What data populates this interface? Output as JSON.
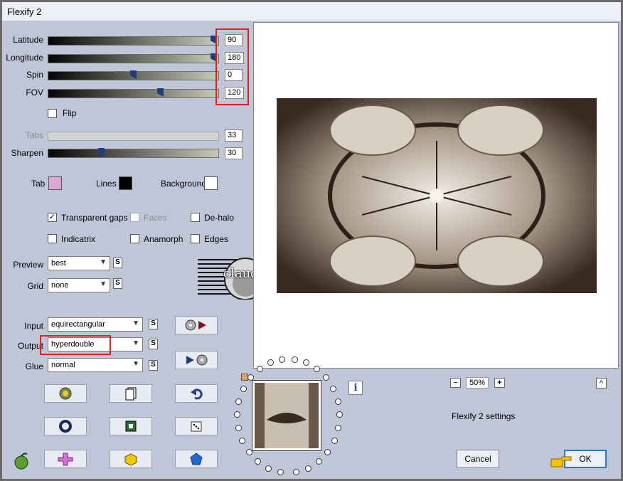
{
  "window": {
    "title": "Flexify 2"
  },
  "sliders": [
    {
      "label": "Latitude",
      "value": "90",
      "position": 1.0
    },
    {
      "label": "Longitude",
      "value": "180",
      "position": 1.0
    },
    {
      "label": "Spin",
      "value": "0",
      "position": 0.5
    },
    {
      "label": "FOV",
      "value": "120",
      "position": 0.67
    },
    {
      "label": "Tabs",
      "value": "33",
      "position": 0.33,
      "disabled": true
    },
    {
      "label": "Sharpen",
      "value": "30",
      "position": 0.3
    }
  ],
  "flip": {
    "label": "Flip",
    "checked": false
  },
  "colors": {
    "tab": {
      "label": "Tab",
      "color": "#d9a8d9"
    },
    "lines": {
      "label": "Lines",
      "color": "#000000"
    },
    "background": {
      "label": "Background",
      "color": "#ffffff"
    },
    "highlight": "#e0221c",
    "accent": "#1e3d7a"
  },
  "options": {
    "transparent_gaps": {
      "label": "Transparent gaps",
      "checked": true
    },
    "faces": {
      "label": "Faces",
      "checked": false,
      "disabled": true
    },
    "de_halo": {
      "label": "De-halo",
      "checked": false
    },
    "indicatrix": {
      "label": "Indicatrix",
      "checked": false
    },
    "anamorph": {
      "label": "Anamorph",
      "checked": false
    },
    "edges": {
      "label": "Edges",
      "checked": false
    }
  },
  "selects": {
    "preview": {
      "label": "Preview",
      "value": "best",
      "s": "S"
    },
    "grid": {
      "label": "Grid",
      "value": "none",
      "s": "S"
    },
    "input": {
      "label": "Input",
      "value": "equirectangular",
      "s": "S"
    },
    "output": {
      "label": "Output",
      "value": "hyperdouble",
      "s": "S"
    },
    "glue": {
      "label": "Glue",
      "value": "normal",
      "s": "S"
    }
  },
  "watermark": {
    "text": "claudia"
  },
  "zoom": {
    "minus": "−",
    "value": "50%",
    "plus": "+",
    "up": "^"
  },
  "info_icon": "i",
  "settings_label": "Flexify 2 settings",
  "buttons": {
    "cancel": "Cancel",
    "ok": "OK"
  },
  "icons": [
    "globe-bug-icon",
    "page-icon",
    "undo-icon",
    "ring-icon",
    "square-frame-icon",
    "dice-icon",
    "cross-icon",
    "cube-icon",
    "pentagon-icon",
    "apple-icon",
    "pointing-hand-icon"
  ]
}
